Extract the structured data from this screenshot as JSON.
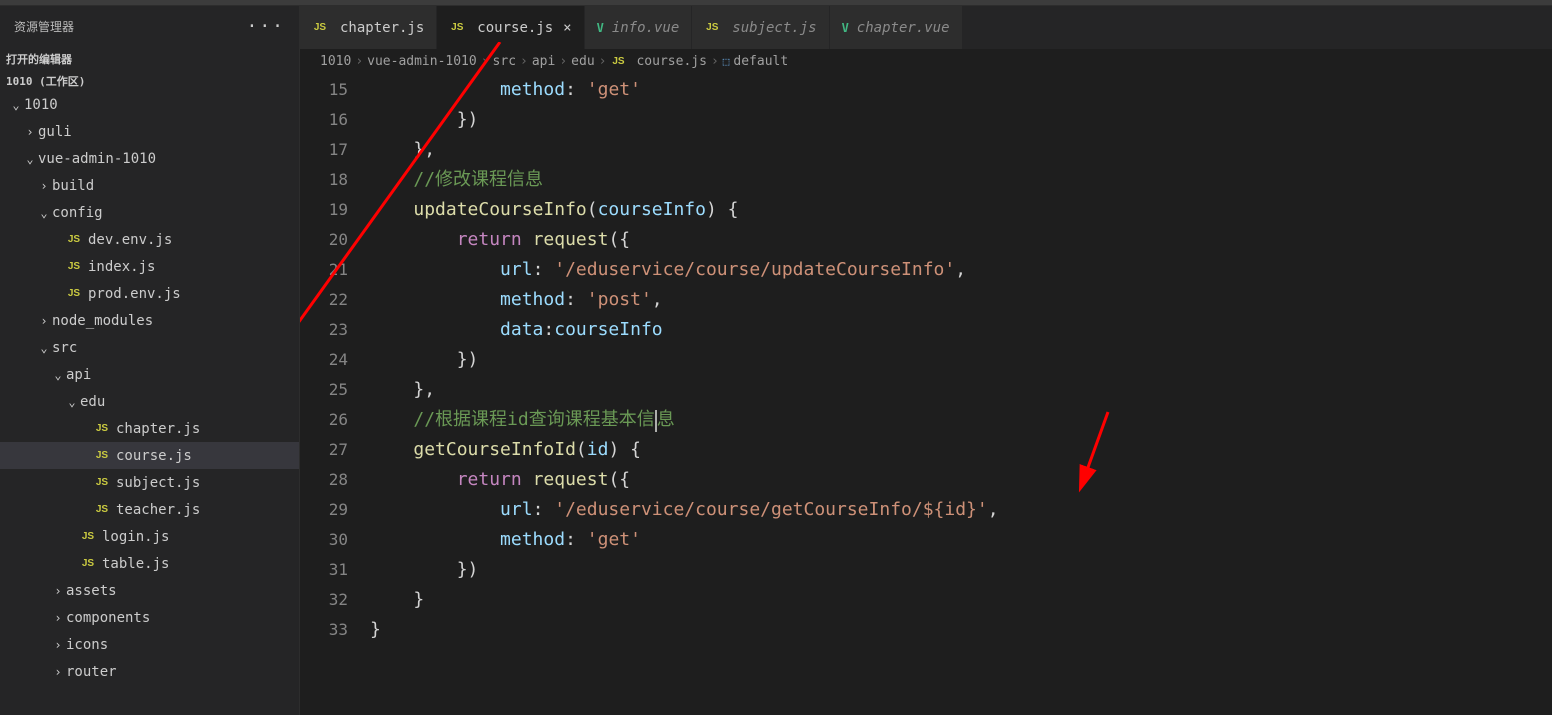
{
  "sidebar": {
    "title": "资源管理器",
    "openEditors": "打开的编辑器",
    "workspace": "1010 (工作区)",
    "tree": [
      {
        "label": "1010",
        "depth": 0,
        "type": "folder",
        "open": true
      },
      {
        "label": "guli",
        "depth": 1,
        "type": "folder",
        "open": false
      },
      {
        "label": "vue-admin-1010",
        "depth": 1,
        "type": "folder",
        "open": true
      },
      {
        "label": "build",
        "depth": 2,
        "type": "folder",
        "open": false
      },
      {
        "label": "config",
        "depth": 2,
        "type": "folder",
        "open": true
      },
      {
        "label": "dev.env.js",
        "depth": 3,
        "type": "js"
      },
      {
        "label": "index.js",
        "depth": 3,
        "type": "js"
      },
      {
        "label": "prod.env.js",
        "depth": 3,
        "type": "js"
      },
      {
        "label": "node_modules",
        "depth": 2,
        "type": "folder",
        "open": false
      },
      {
        "label": "src",
        "depth": 2,
        "type": "folder",
        "open": true
      },
      {
        "label": "api",
        "depth": 3,
        "type": "folder",
        "open": true
      },
      {
        "label": "edu",
        "depth": 4,
        "type": "folder",
        "open": true
      },
      {
        "label": "chapter.js",
        "depth": 5,
        "type": "js"
      },
      {
        "label": "course.js",
        "depth": 5,
        "type": "js",
        "selected": true
      },
      {
        "label": "subject.js",
        "depth": 5,
        "type": "js"
      },
      {
        "label": "teacher.js",
        "depth": 5,
        "type": "js"
      },
      {
        "label": "login.js",
        "depth": 4,
        "type": "js"
      },
      {
        "label": "table.js",
        "depth": 4,
        "type": "js"
      },
      {
        "label": "assets",
        "depth": 3,
        "type": "folder",
        "open": false
      },
      {
        "label": "components",
        "depth": 3,
        "type": "folder",
        "open": false
      },
      {
        "label": "icons",
        "depth": 3,
        "type": "folder",
        "open": false
      },
      {
        "label": "router",
        "depth": 3,
        "type": "folder",
        "open": false
      }
    ]
  },
  "tabs": [
    {
      "name": "chapter.js",
      "icon": "js"
    },
    {
      "name": "course.js",
      "icon": "js",
      "active": true,
      "closeVisible": true
    },
    {
      "name": "info.vue",
      "icon": "vue",
      "italic": true
    },
    {
      "name": "subject.js",
      "icon": "js",
      "italic": true
    },
    {
      "name": "chapter.vue",
      "icon": "vue",
      "italic": true
    }
  ],
  "breadcrumb": {
    "parts": [
      "1010",
      "vue-admin-1010",
      "src",
      "api",
      "edu"
    ],
    "file": "course.js",
    "symbol": "default"
  },
  "code": {
    "start": 15,
    "lines": [
      [
        [
          "sp",
          "            "
        ],
        [
          "prop",
          "method"
        ],
        [
          "plain",
          ": "
        ],
        [
          "str",
          "'get'"
        ]
      ],
      [
        [
          "sp",
          "        "
        ],
        [
          "plain",
          "})"
        ]
      ],
      [
        [
          "sp",
          "    "
        ],
        [
          "plain",
          "},"
        ]
      ],
      [
        [
          "sp",
          "    "
        ],
        [
          "cmt",
          "//修改课程信息"
        ]
      ],
      [
        [
          "sp",
          "    "
        ],
        [
          "fn",
          "updateCourseInfo"
        ],
        [
          "plain",
          "("
        ],
        [
          "param",
          "courseInfo"
        ],
        [
          "plain",
          ") {"
        ]
      ],
      [
        [
          "sp",
          "        "
        ],
        [
          "kw",
          "return"
        ],
        [
          "plain",
          " "
        ],
        [
          "fn",
          "request"
        ],
        [
          "plain",
          "({"
        ]
      ],
      [
        [
          "sp",
          "            "
        ],
        [
          "prop",
          "url"
        ],
        [
          "plain",
          ": "
        ],
        [
          "str",
          "'/eduservice/course/updateCourseInfo'"
        ],
        [
          "plain",
          ","
        ]
      ],
      [
        [
          "sp",
          "            "
        ],
        [
          "prop",
          "method"
        ],
        [
          "plain",
          ": "
        ],
        [
          "str",
          "'post'"
        ],
        [
          "plain",
          ","
        ]
      ],
      [
        [
          "sp",
          "            "
        ],
        [
          "prop",
          "data"
        ],
        [
          "plain",
          ":"
        ],
        [
          "param",
          "courseInfo"
        ]
      ],
      [
        [
          "sp",
          "        "
        ],
        [
          "plain",
          "})"
        ]
      ],
      [
        [
          "sp",
          "    "
        ],
        [
          "plain",
          "},"
        ]
      ],
      [
        [
          "sp",
          "    "
        ],
        [
          "cmt",
          "//根据课程id查询课程基本信"
        ],
        [
          "caret",
          ""
        ],
        [
          "cmt",
          "息"
        ]
      ],
      [
        [
          "sp",
          "    "
        ],
        [
          "fn",
          "getCourseInfoId"
        ],
        [
          "plain",
          "("
        ],
        [
          "param",
          "id"
        ],
        [
          "plain",
          ") {"
        ]
      ],
      [
        [
          "sp",
          "        "
        ],
        [
          "kw",
          "return"
        ],
        [
          "plain",
          " "
        ],
        [
          "fn",
          "request"
        ],
        [
          "plain",
          "({"
        ]
      ],
      [
        [
          "sp",
          "            "
        ],
        [
          "prop",
          "url"
        ],
        [
          "plain",
          ": "
        ],
        [
          "str",
          "'/eduservice/course/getCourseInfo/${id}'"
        ],
        [
          "plain",
          ","
        ]
      ],
      [
        [
          "sp",
          "            "
        ],
        [
          "prop",
          "method"
        ],
        [
          "plain",
          ": "
        ],
        [
          "str",
          "'get'"
        ]
      ],
      [
        [
          "sp",
          "        "
        ],
        [
          "plain",
          "})"
        ]
      ],
      [
        [
          "sp",
          "    "
        ],
        [
          "plain",
          "}"
        ]
      ],
      [
        [
          "plain",
          "}"
        ]
      ]
    ]
  },
  "icons": {
    "js": "JS",
    "vue": "V"
  }
}
